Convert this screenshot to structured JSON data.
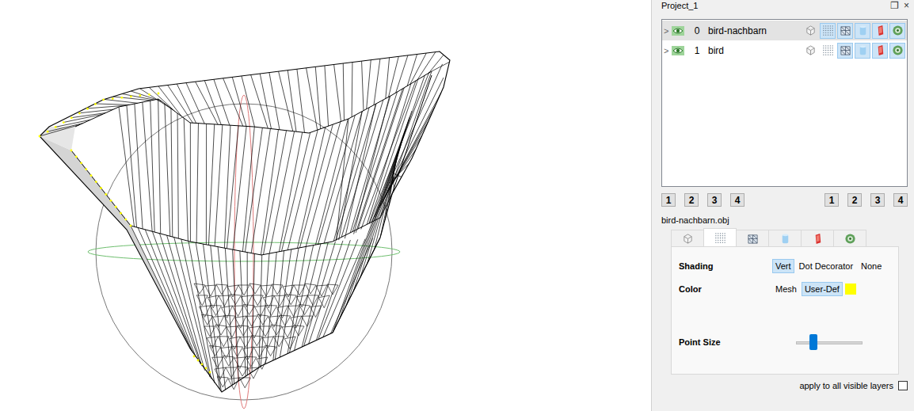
{
  "window": {
    "title": "Project_1",
    "controls": [
      "❐",
      "×"
    ]
  },
  "layers": [
    {
      "index": "0",
      "name": "bird-nachbarn",
      "expander": ">",
      "visible": true,
      "selected": true,
      "toggles": [
        {
          "kind": "box",
          "on": false
        },
        {
          "kind": "points",
          "on": true
        },
        {
          "kind": "wire",
          "on": true
        },
        {
          "kind": "smooth",
          "on": true
        },
        {
          "kind": "tool",
          "on": true
        },
        {
          "kind": "texture",
          "on": true
        }
      ]
    },
    {
      "index": "1",
      "name": "bird",
      "expander": ">",
      "visible": true,
      "selected": false,
      "toggles": [
        {
          "kind": "box",
          "on": false
        },
        {
          "kind": "points",
          "on": false
        },
        {
          "kind": "wire",
          "on": true
        },
        {
          "kind": "smooth",
          "on": true
        },
        {
          "kind": "tool",
          "on": true
        },
        {
          "kind": "texture",
          "on": true
        }
      ]
    }
  ],
  "layer_buttons": {
    "left": [
      "1",
      "2",
      "3",
      "4"
    ],
    "right": [
      "1",
      "2",
      "3",
      "4"
    ]
  },
  "properties": {
    "title": "bird-nachbarn.obj",
    "tabs": [
      {
        "kind": "box",
        "selected": false
      },
      {
        "kind": "points",
        "selected": true
      },
      {
        "kind": "wire",
        "selected": false
      },
      {
        "kind": "smooth",
        "selected": false
      },
      {
        "kind": "tool",
        "selected": false
      },
      {
        "kind": "texture",
        "selected": false
      }
    ],
    "shading": {
      "label": "Shading",
      "options": [
        {
          "label": "Vert",
          "selected": true
        },
        {
          "label": "Dot Decorator",
          "selected": false
        },
        {
          "label": "None",
          "selected": false
        }
      ]
    },
    "color": {
      "label": "Color",
      "options": [
        {
          "label": "Mesh",
          "selected": false
        },
        {
          "label": "User-Def",
          "selected": true
        }
      ],
      "swatch": "#ffff00"
    },
    "point_size": {
      "label": "Point Size",
      "level": 0.23
    },
    "apply_all": {
      "label": "apply to all visible layers",
      "checked": false
    }
  }
}
